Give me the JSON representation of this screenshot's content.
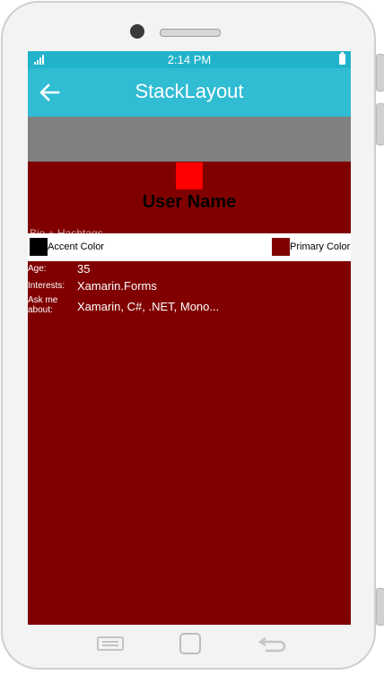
{
  "status_bar": {
    "time": "2:14 PM"
  },
  "nav_bar": {
    "title": "StackLayout"
  },
  "profile": {
    "user_name": "User Name",
    "bio": "Bio + Hashtags"
  },
  "colors": {
    "accent_label": "Accent Color",
    "primary_label": "Primary Color",
    "accent": "#000000",
    "primary": "#800000",
    "statusbar": "#20b3cb",
    "navbar": "#30bcd3"
  },
  "fields": {
    "age": {
      "label": "Age:",
      "value": "35"
    },
    "interests": {
      "label": "Interests:",
      "value": "Xamarin.Forms"
    },
    "ask": {
      "label_line1": "Ask me",
      "label_line2": "about:",
      "value": "Xamarin, C#, .NET, Mono..."
    }
  },
  "icons": [
    "signal-icon",
    "battery-icon",
    "back-arrow-icon",
    "menu-key-icon",
    "home-key-icon",
    "back-key-icon"
  ]
}
